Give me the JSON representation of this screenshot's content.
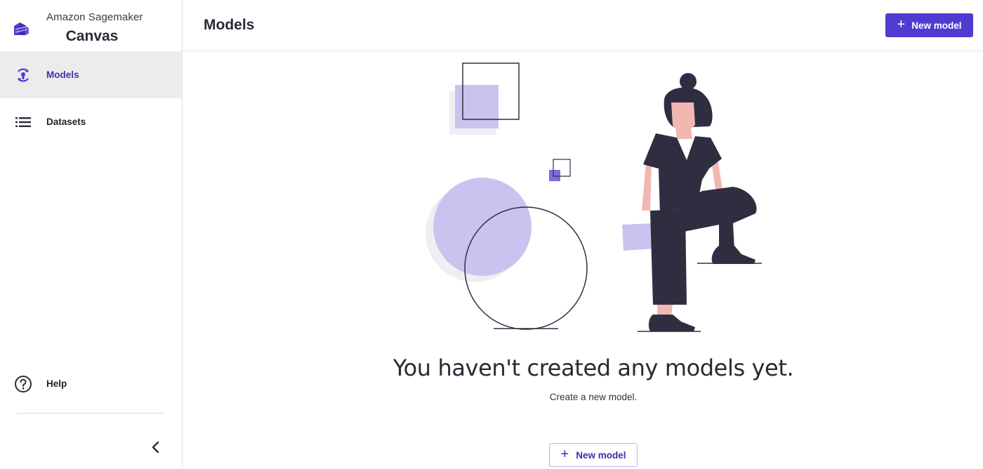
{
  "brand": {
    "subtitle": "Amazon Sagemaker",
    "title": "Canvas"
  },
  "sidebar": {
    "items": [
      {
        "label": "Models",
        "icon": "models-icon",
        "active": true
      },
      {
        "label": "Datasets",
        "icon": "list-icon",
        "active": false
      }
    ],
    "help_label": "Help"
  },
  "header": {
    "title": "Models",
    "new_model_label": "New model"
  },
  "empty_state": {
    "title": "You haven't created any models yet.",
    "subtitle": "Create a new model.",
    "button_label": "New model"
  },
  "colors": {
    "accent": "#4f3bd2",
    "accent_light": "#c9c3ef",
    "figure_dark": "#2f2e41",
    "skin": "#f3b7b2"
  }
}
